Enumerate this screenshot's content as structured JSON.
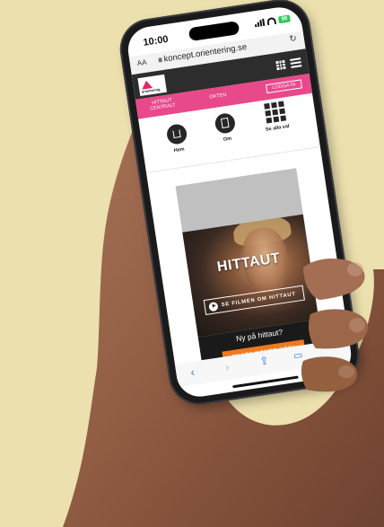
{
  "status_bar": {
    "time": "10:00",
    "battery": "99"
  },
  "browser": {
    "text_size_label": "AA",
    "url": "koncept.orientering.se",
    "reload_icon": "reload-icon"
  },
  "site": {
    "logo_text": "orientering",
    "nav": {
      "item1": "HITTAUT CENTRALT",
      "item2": "OKTEN",
      "login": "LOGGA IN"
    },
    "quick_links": [
      {
        "label": "Hem",
        "icon": "home-icon"
      },
      {
        "label": "Om",
        "icon": "info-icon"
      },
      {
        "label": "Se alla val",
        "icon": "grid-icon"
      }
    ],
    "hero": {
      "title": "HITTAUT",
      "video_button": "SE FILMEN OM HITTAUT"
    },
    "signup": {
      "question": "Ny på hittaut?",
      "button": "SKAPA KONTO HÄR!"
    }
  },
  "colors": {
    "background": "#ece0ae",
    "pink": "#e8498a",
    "orange": "#ef7a1f",
    "dark_header": "#2d2d2d",
    "safari_blue": "#2f7bf0"
  }
}
